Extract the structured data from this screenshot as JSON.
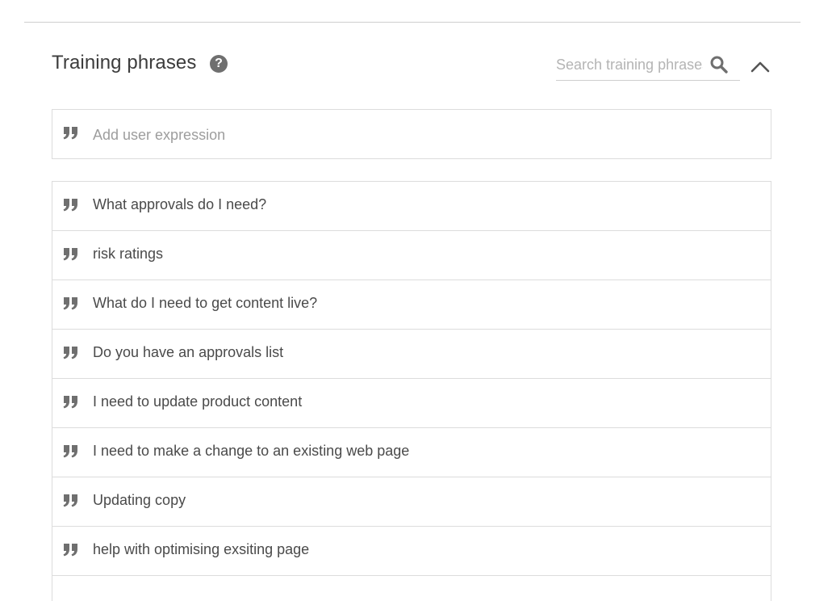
{
  "section": {
    "title": "Training phrases",
    "help_icon": "question-circle-icon",
    "collapse_icon": "chevron-up-icon"
  },
  "search": {
    "placeholder": "Search training phrases",
    "icon": "search-icon"
  },
  "add_expression": {
    "placeholder": "Add user expression",
    "icon": "quote-icon"
  },
  "phrases": [
    {
      "text": "What approvals do I need?"
    },
    {
      "text": "risk ratings"
    },
    {
      "text": "What do I need to get content live?"
    },
    {
      "text": "Do you have an approvals list"
    },
    {
      "text": "I need to update product content"
    },
    {
      "text": "I need to make a change to an existing web page"
    },
    {
      "text": "Updating copy"
    },
    {
      "text": "help with optimising exsiting page"
    }
  ],
  "colors": {
    "icon": "#6f6f6f",
    "border": "#dcdcdc",
    "text": "#4a4a4a",
    "placeholder": "#9d9d9d"
  }
}
